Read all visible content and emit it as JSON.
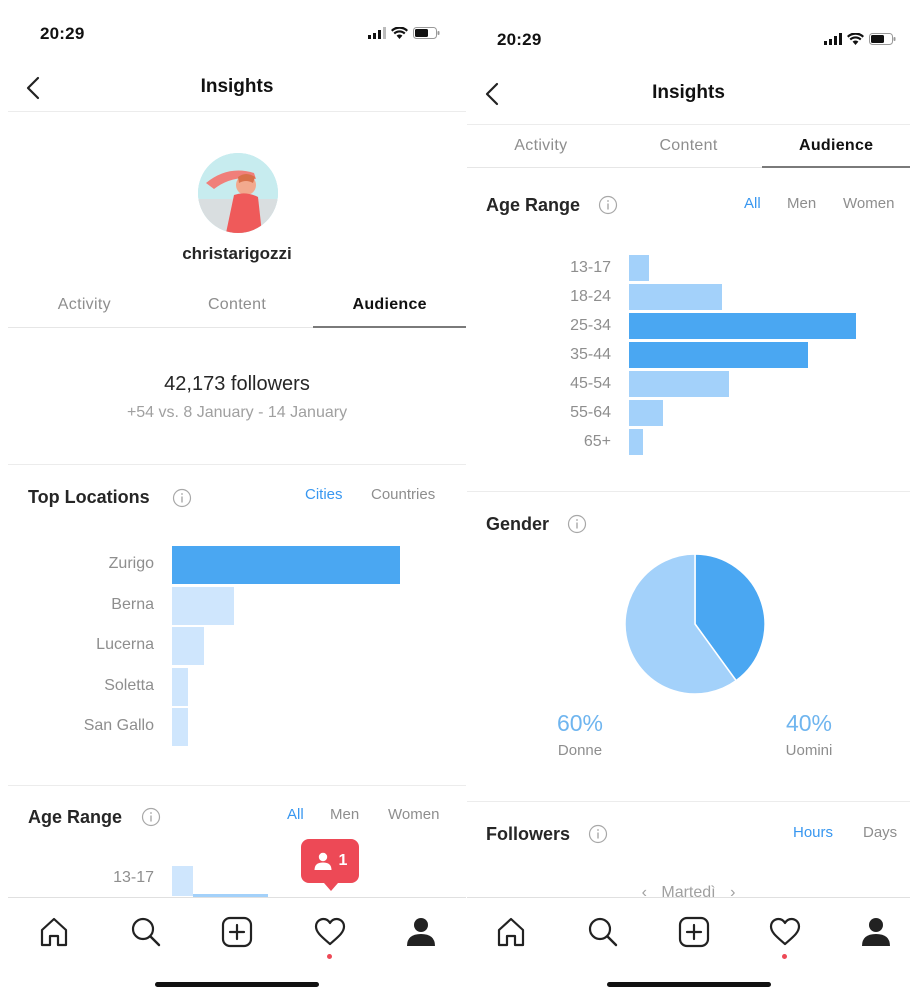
{
  "left_screen": {
    "status_time": "20:29",
    "nav_title": "Insights",
    "username": "christarigozzi",
    "tabs": [
      "Activity",
      "Content",
      "Audience"
    ],
    "active_tab": "Audience",
    "followers_count": "42,173 followers",
    "followers_change": "+54 vs. 8 January - 14 January",
    "top_locations": {
      "title": "Top Locations",
      "filters": [
        "Cities",
        "Countries"
      ],
      "active_filter": "Cities",
      "cities": [
        "Zurigo",
        "Berna",
        "Lucerna",
        "Soletta",
        "San Gallo"
      ],
      "relative_values": [
        1.0,
        0.27,
        0.14,
        0.07,
        0.07
      ]
    },
    "age_range": {
      "title": "Age Range",
      "filters": [
        "All",
        "Men",
        "Women"
      ],
      "active_filter": "All",
      "first_label": "13-17"
    },
    "notification": {
      "count": "1",
      "icon": "person-icon"
    }
  },
  "right_screen": {
    "status_time": "20:29",
    "nav_title": "Insights",
    "tabs": [
      "Activity",
      "Content",
      "Audience"
    ],
    "active_tab": "Audience",
    "age_range": {
      "title": "Age Range",
      "filters": [
        "All",
        "Men",
        "Women"
      ],
      "active_filter": "All",
      "ranges": [
        "13-17",
        "18-24",
        "25-34",
        "35-44",
        "45-54",
        "55-64",
        "65+"
      ],
      "relative_values": [
        0.09,
        0.41,
        1.0,
        0.79,
        0.44,
        0.15,
        0.06
      ],
      "highlighted": [
        "25-34",
        "35-44"
      ]
    },
    "gender": {
      "title": "Gender",
      "segments": [
        {
          "label": "Donne",
          "percent_text": "60%",
          "value": 60,
          "color": "#a3d1fa"
        },
        {
          "label": "Uomini",
          "percent_text": "40%",
          "value": 40,
          "color": "#4aa7f2"
        }
      ]
    },
    "followers_section": {
      "title": "Followers",
      "filters": [
        "Hours",
        "Days"
      ],
      "active_filter": "Hours",
      "day_selector": "Martedì"
    }
  },
  "tabbar_icons": [
    "home-icon",
    "search-icon",
    "new-post-icon",
    "activity-heart-icon",
    "profile-icon"
  ],
  "colors": {
    "accent_blue": "#3897f0",
    "bar_strong": "#4aa7f2",
    "bar_medium": "#a3d1fa",
    "bar_light": "#cfe6fd",
    "notification_red": "#ed4956"
  }
}
